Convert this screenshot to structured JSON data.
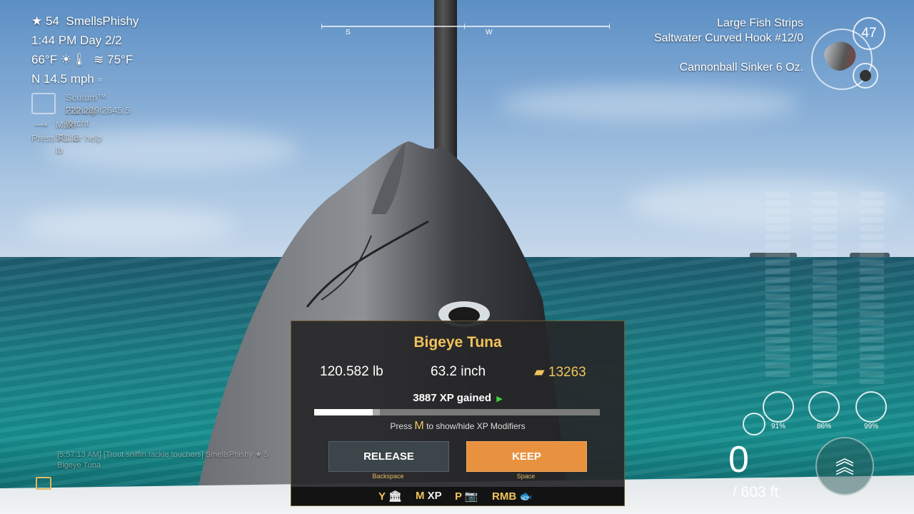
{
  "player": {
    "level": "54",
    "name": "SmellsPhishy"
  },
  "time": {
    "clock": "1:44 PM",
    "day": "Day 2/2"
  },
  "weather": {
    "air_temp": "66°F",
    "water_temp": "75°F",
    "wind": "N 14.5 mph"
  },
  "boat": {
    "name": "Scutum™ Fishing Yacht",
    "load": "222.239/2645.5 lb",
    "max_fish": "Max: 551.2 lb"
  },
  "help": "Press F1 for help",
  "compass": {
    "left": "S",
    "right": "W"
  },
  "tackle": {
    "bait": "Large Fish Strips",
    "hook": "Saltwater Curved Hook #12/0",
    "sinker": "Cannonball Sinker 6 Oz.",
    "bait_count": "47"
  },
  "gauges": [
    {
      "name": "line",
      "value": "91%"
    },
    {
      "name": "rod",
      "value": "86%"
    },
    {
      "name": "reel",
      "value": "99%"
    }
  ],
  "depth": {
    "current": "0",
    "max": "/ 603 ft"
  },
  "chat": {
    "line1": "[5:57:13 AM] [Trout sniffin tackle touchers] SmellsPhishy ★ 5",
    "line2": "Bigeye Tuna"
  },
  "catch": {
    "species": "Bigeye Tuna",
    "weight": "120.582 lb",
    "length": "63.2 inch",
    "value": "13263",
    "xp": "3887 XP gained",
    "xp_progress": 0.21,
    "hint_prefix": "Press",
    "hint_key": "M",
    "hint_suffix": "to show/hide XP Modifiers",
    "release_label": "RELEASE",
    "release_key": "Backspace",
    "keep_label": "KEEP",
    "keep_key": "Space",
    "footer": [
      {
        "key": "Y",
        "icon": "🏛"
      },
      {
        "key": "M",
        "icon": "XP"
      },
      {
        "key": "P",
        "icon": "📷"
      },
      {
        "key": "RMB",
        "icon": "🐟"
      }
    ]
  },
  "colors": {
    "accent": "#f2c35a",
    "keep": "#e8923f",
    "release": "#3c4549"
  }
}
